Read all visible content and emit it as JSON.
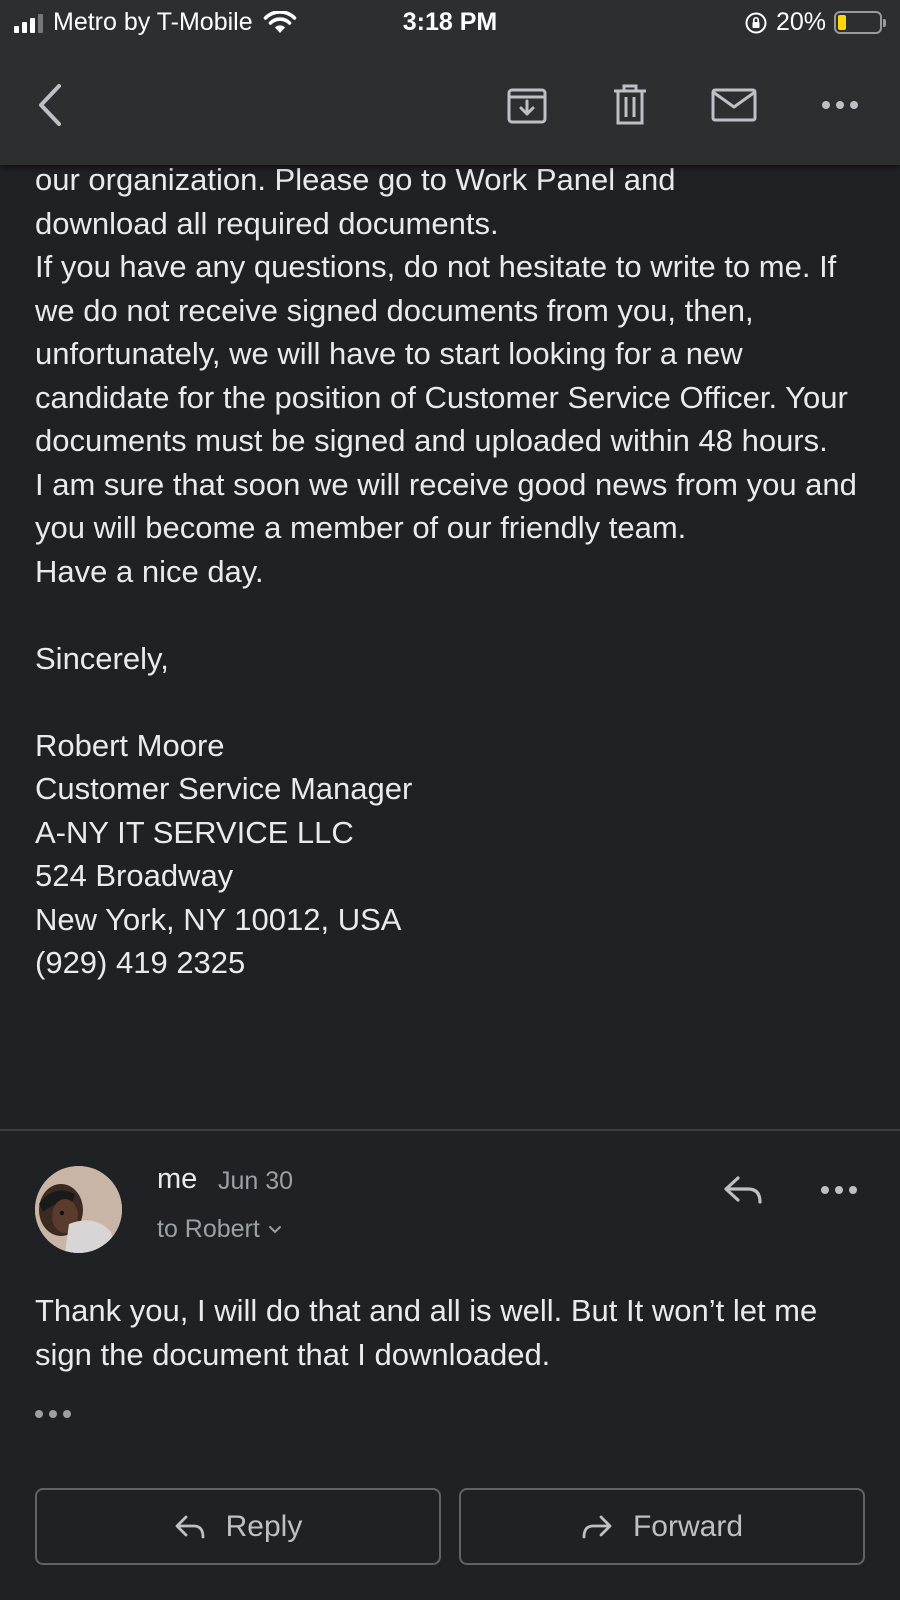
{
  "status_bar": {
    "carrier": "Metro by T-Mobile",
    "time": "3:18 PM",
    "battery_percent": "20%",
    "battery_level": 0.2,
    "battery_color": "#ffd60a"
  },
  "toolbar": {
    "icons": [
      "back-icon",
      "archive-icon",
      "trash-icon",
      "mark-unread-icon",
      "more-icon"
    ]
  },
  "email": {
    "body_lines": [
      "our organization. Please go to Work Panel and\ndownload all required documents.",
      "If you have any questions, do not hesitate to write to me. If we do not receive signed documents from you, then, unfortunately, we will have to start looking for a new candidate for the position of Customer Service Officer. Your documents must be signed and uploaded within 48 hours.",
      "I am sure that soon we will receive good news from you and you will become a member of our friendly team.",
      "Have a nice day."
    ],
    "closing": "Sincerely,",
    "signature": {
      "name": "Robert Moore",
      "title": "Customer Service Manager",
      "company": "A-NY IT SERVICE LLC",
      "address_line1": "524 Broadway",
      "address_line2": "New York, NY 10012, USA",
      "phone": "(929) 419 2325"
    }
  },
  "reply_message": {
    "sender": "me",
    "date": "Jun 30",
    "recipient": "to Robert",
    "body": "Thank you, I will do that and all is well. But It won’t let me sign the document that I downloaded."
  },
  "actions": {
    "reply_label": "Reply",
    "forward_label": "Forward"
  }
}
